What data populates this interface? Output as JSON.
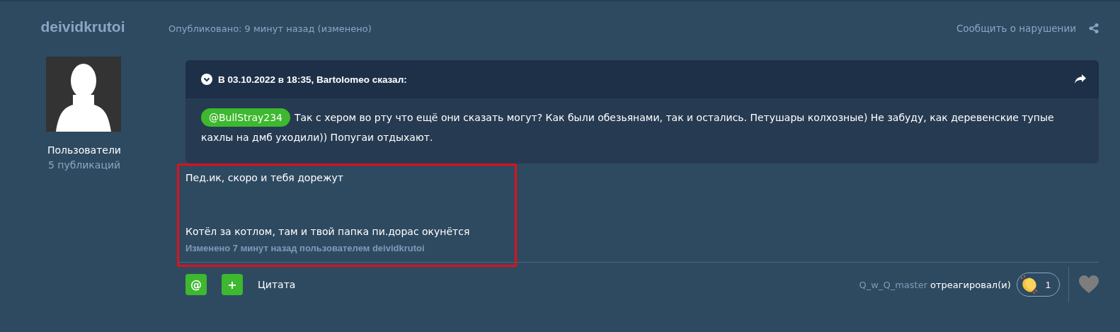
{
  "author": {
    "name": "deividkrutoi",
    "group": "Пользователи",
    "posts": "5 публикаций"
  },
  "post_meta": {
    "published": "Опубликовано: 9 минут назад (изменено)",
    "report": "Сообщить о нарушении"
  },
  "quote": {
    "header": "В 03.10.2022 в 18:35, Bartolomeo сказал:",
    "mention": "@BullStray234",
    "text": "Так с хером во рту что ещё они сказать могут? Как были обезьянами, так и остались. Петушары колхозные) Не забуду, как деревенские тупые кахлы на дмб уходили)) Попугаи отдыхают."
  },
  "body": [
    "Пед.ик, скоро и тебя дорежут",
    "Котёл за котлом, там и твой папка пи.дорас окунётся"
  ],
  "edited_note": "Изменено 7 минут назад пользователем deividkrutoi",
  "footer": {
    "mention_button": "@",
    "add_button": "+",
    "quote_link": "Цитата",
    "reactor": "Q_w_Q_master",
    "reacted": "отреагировал(и)",
    "reaction_count": "1"
  }
}
